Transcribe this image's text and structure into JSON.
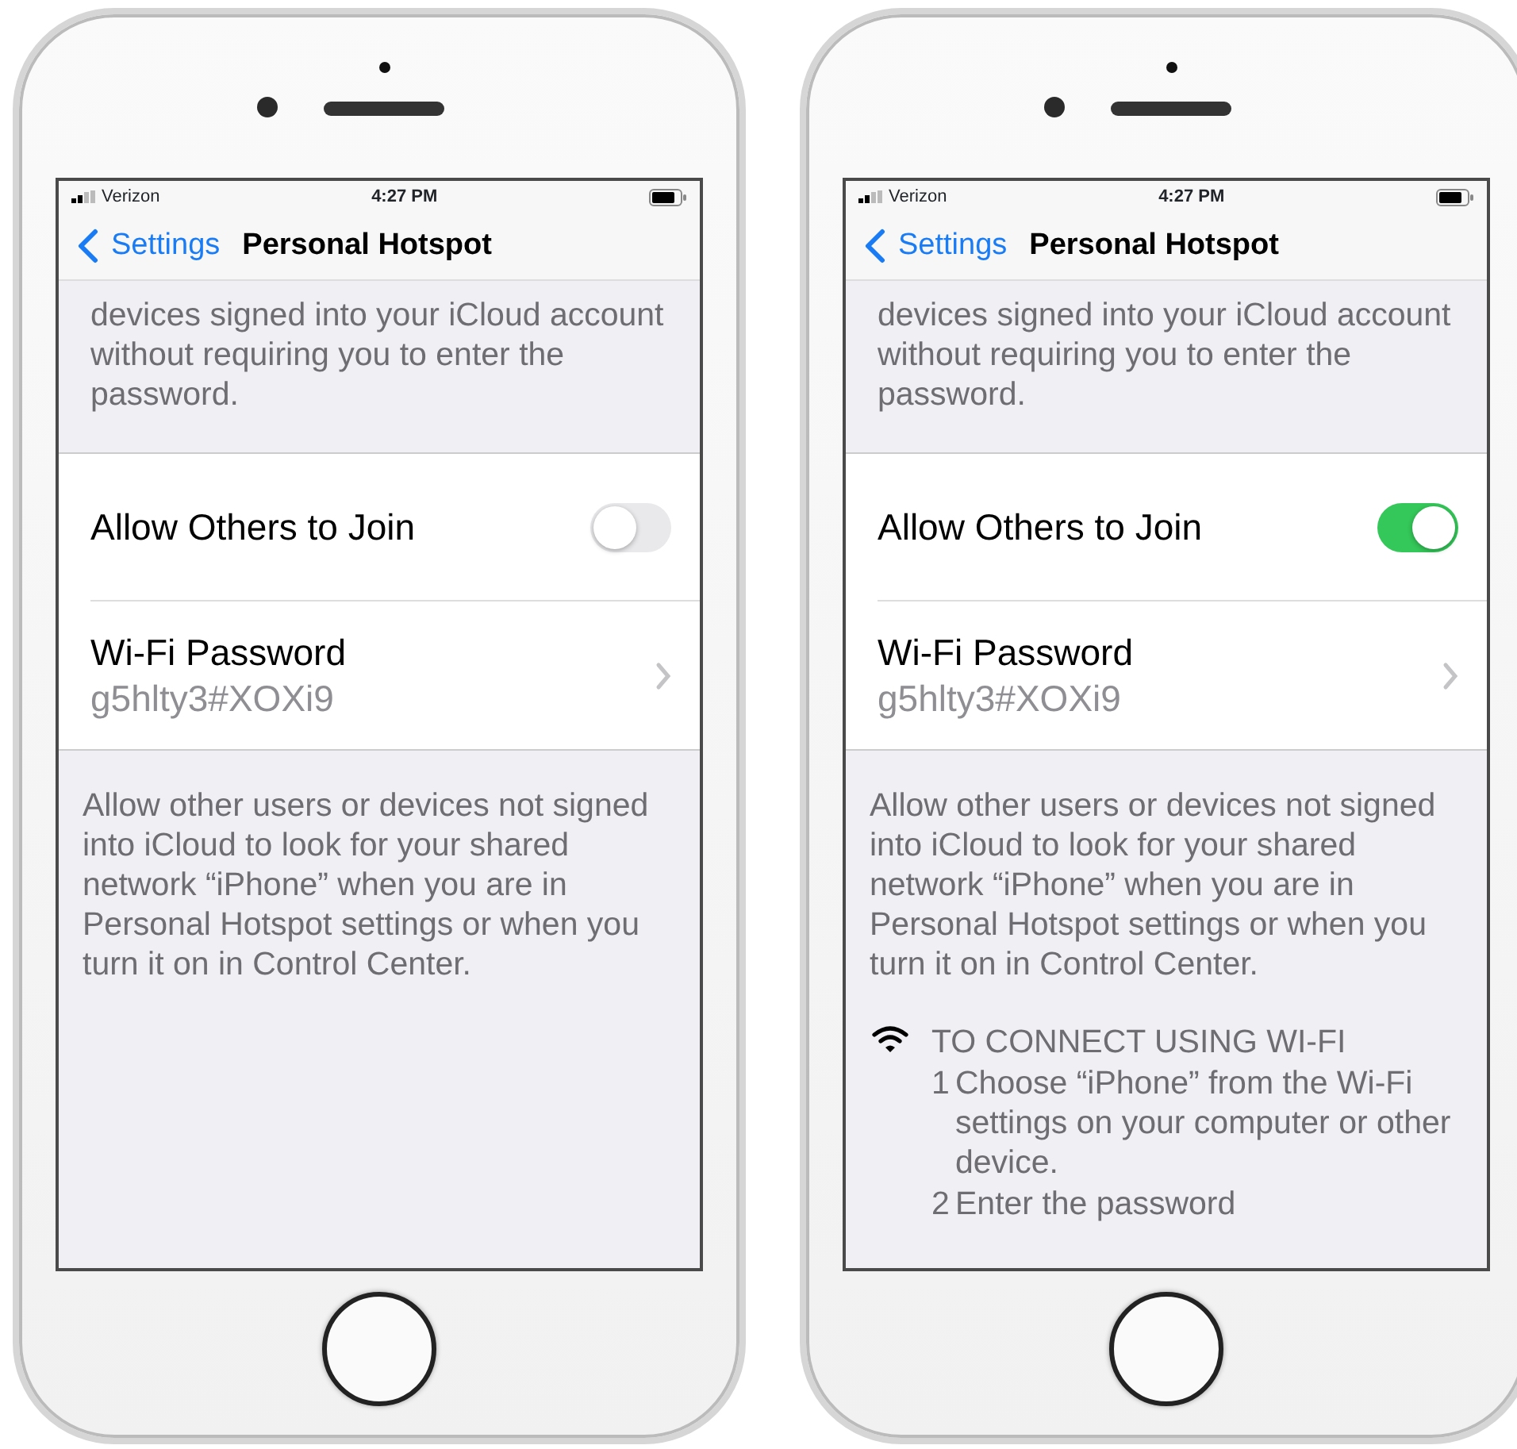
{
  "phones": [
    {
      "status": {
        "carrier": "Verizon",
        "time": "4:27 PM"
      },
      "nav": {
        "back": "Settings",
        "title": "Personal Hotspot"
      },
      "top_text": "devices signed into your iCloud account without requiring you to enter the password.",
      "rows": [
        {
          "kind": "toggle",
          "label": "Allow Others to Join",
          "on": false
        },
        {
          "kind": "detail",
          "label": "Wi-Fi Password",
          "value": "g5hlty3#XOXi9"
        }
      ],
      "footer": "Allow other users or devices not signed into iCloud to look for your shared network “iPhone” when you are in Personal Hotspot settings or when you turn it on in Control Center."
    },
    {
      "status": {
        "carrier": "Verizon",
        "time": "4:27 PM"
      },
      "nav": {
        "back": "Settings",
        "title": "Personal Hotspot"
      },
      "top_text": "devices signed into your iCloud account without requiring you to enter the password.",
      "rows": [
        {
          "kind": "toggle",
          "label": "Allow Others to Join",
          "on": true
        },
        {
          "kind": "detail",
          "label": "Wi-Fi Password",
          "value": "g5hlty3#XOXi9"
        }
      ],
      "footer": "Allow other users or devices not signed into iCloud to look for your shared network “iPhone” when you are in Personal Hotspot settings or when you turn it on in Control Center.",
      "instructions": {
        "heading": "TO CONNECT USING WI-FI",
        "steps": [
          {
            "number": "1",
            "text": "Choose “iPhone” from the Wi-Fi settings on your computer or other device."
          },
          {
            "number": "2",
            "text": "Enter the password"
          }
        ]
      }
    }
  ]
}
